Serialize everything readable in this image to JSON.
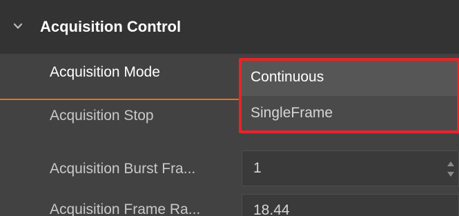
{
  "section": {
    "title": "Acquisition Control",
    "expanded": true,
    "icon": "chevron-down-icon"
  },
  "rows": [
    {
      "label": "Acquisition Mode",
      "value": "Continuous"
    },
    {
      "label": "Acquisition Stop"
    },
    {
      "label": "Acquisition Burst Fra...",
      "value": "1"
    },
    {
      "label": "Acquisition Frame Ra...",
      "value": "18.44"
    }
  ],
  "dropdown": {
    "options": [
      "Continuous",
      "SingleFrame"
    ],
    "selected": "Continuous"
  },
  "spinner": {
    "up_icon": "triangle-up-icon",
    "down_icon": "triangle-down-icon"
  },
  "colors": {
    "accent_line": "#d9762a",
    "highlight_border": "#e8232b",
    "background": "#424242",
    "header_background": "#333333"
  }
}
